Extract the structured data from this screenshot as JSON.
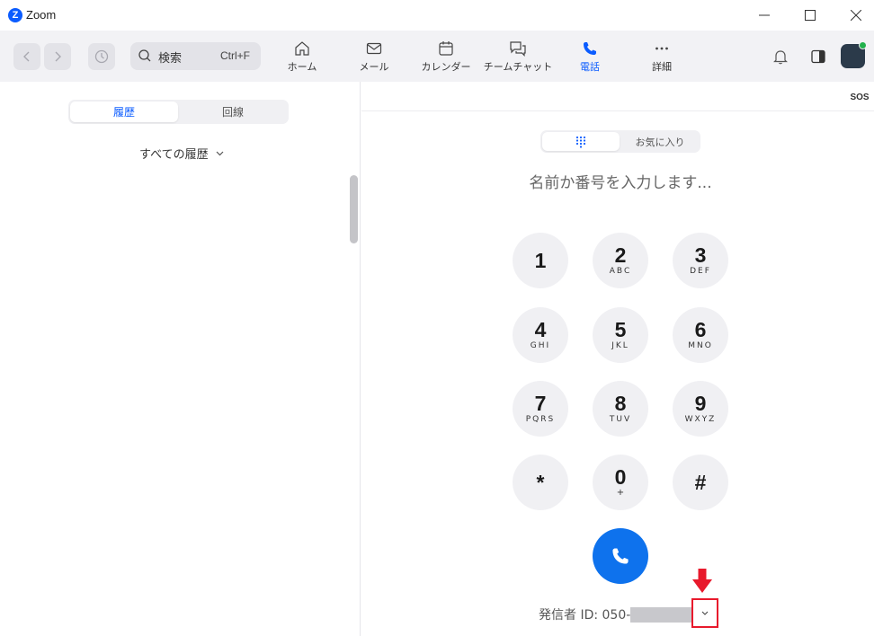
{
  "window": {
    "logo_letter": "Z",
    "title": "Zoom",
    "minimize_symbol": "—",
    "maximize_symbol": "☐",
    "close_symbol": "✕"
  },
  "toolbar": {
    "search_label": "検索",
    "search_shortcut": "Ctrl+F",
    "tabs": [
      {
        "label": "ホーム",
        "icon": "home-icon",
        "active": false
      },
      {
        "label": "メール",
        "icon": "mail-icon",
        "active": false
      },
      {
        "label": "カレンダー",
        "icon": "calendar-icon",
        "active": false
      },
      {
        "label": "チームチャット",
        "icon": "chat-icon",
        "active": false
      },
      {
        "label": "電話",
        "icon": "phone-icon",
        "active": true
      },
      {
        "label": "詳細",
        "icon": "more-icon",
        "active": false
      }
    ],
    "accent_color": "#0b5cff"
  },
  "left_panel": {
    "segments": [
      "履歴",
      "回線"
    ],
    "active_segment": "履歴",
    "filter_label": "すべての履歴"
  },
  "right_panel": {
    "sos_label": "SOS",
    "dial_segments": [
      "keypad",
      "お気に入り"
    ],
    "favorites_label": "お気に入り",
    "placeholder": "名前か番号を入力します...",
    "keys": [
      {
        "digit": "1",
        "letters": ""
      },
      {
        "digit": "2",
        "letters": "ABC"
      },
      {
        "digit": "3",
        "letters": "DEF"
      },
      {
        "digit": "4",
        "letters": "GHI"
      },
      {
        "digit": "5",
        "letters": "JKL"
      },
      {
        "digit": "6",
        "letters": "MNO"
      },
      {
        "digit": "7",
        "letters": "PQRS"
      },
      {
        "digit": "8",
        "letters": "TUV"
      },
      {
        "digit": "9",
        "letters": "WXYZ"
      },
      {
        "digit": "*",
        "letters": ""
      },
      {
        "digit": "0",
        "letters": "+"
      },
      {
        "digit": "#",
        "letters": ""
      }
    ],
    "caller_id_label": "発信者 ID: 050-",
    "call_button_color": "#0e72ed",
    "highlight_color": "#e8192c"
  }
}
